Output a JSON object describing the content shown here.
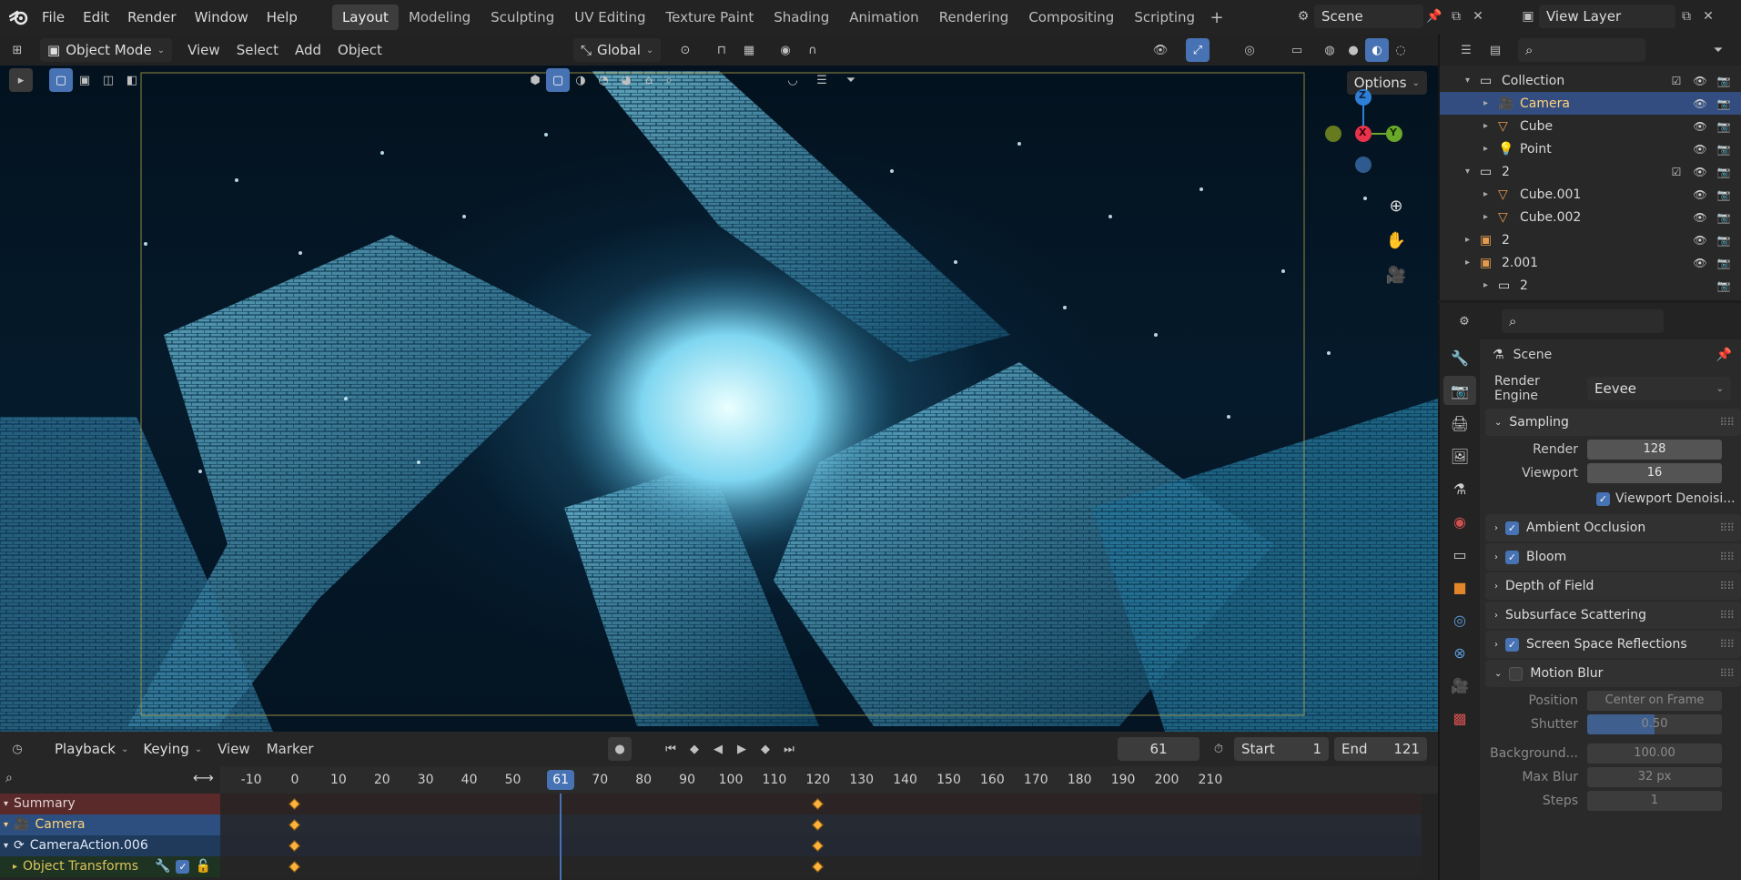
{
  "menu": [
    "File",
    "Edit",
    "Render",
    "Window",
    "Help"
  ],
  "workspaces": [
    {
      "label": "Layout",
      "active": true
    },
    {
      "label": "Modeling"
    },
    {
      "label": "Sculpting"
    },
    {
      "label": "UV Editing"
    },
    {
      "label": "Texture Paint"
    },
    {
      "label": "Shading"
    },
    {
      "label": "Animation"
    },
    {
      "label": "Rendering"
    },
    {
      "label": "Compositing"
    },
    {
      "label": "Scripting"
    }
  ],
  "scene": {
    "name": "Scene"
  },
  "view_layer": {
    "name": "View Layer"
  },
  "viewport": {
    "mode": "Object Mode",
    "menus": [
      "View",
      "Select",
      "Add",
      "Object"
    ],
    "transform_orientation": "Global",
    "options_label": "Options",
    "gizmo": {
      "z": "Z",
      "x": "X",
      "y": "Y"
    }
  },
  "outliner": {
    "rows": [
      {
        "label": "Collection",
        "indent": 1,
        "icon": "collection",
        "checkbox": true
      },
      {
        "label": "Camera",
        "indent": 2,
        "icon": "camera",
        "selected": true
      },
      {
        "label": "Cube",
        "indent": 2,
        "icon": "mesh"
      },
      {
        "label": "Point",
        "indent": 2,
        "icon": "light"
      },
      {
        "label": "2",
        "indent": 1,
        "icon": "collection",
        "checkbox": true
      },
      {
        "label": "Cube.001",
        "indent": 2,
        "icon": "mesh"
      },
      {
        "label": "Cube.002",
        "indent": 2,
        "icon": "mesh"
      },
      {
        "label": "2",
        "indent": 1,
        "icon": "instance"
      },
      {
        "label": "2.001",
        "indent": 1,
        "icon": "instance"
      },
      {
        "label": "2",
        "indent": 2,
        "icon": "collection-sub"
      }
    ]
  },
  "properties": {
    "context": "Scene",
    "render_engine_label": "Render Engine",
    "render_engine": "Eevee",
    "sampling": {
      "title": "Sampling",
      "render_label": "Render",
      "render": "128",
      "viewport_label": "Viewport",
      "viewport": "16",
      "denoise_label": "Viewport Denoisi..."
    },
    "panels": [
      {
        "label": "Ambient Occlusion",
        "checkbox": true,
        "checked": true
      },
      {
        "label": "Bloom",
        "checkbox": true,
        "checked": true
      },
      {
        "label": "Depth of Field",
        "checkbox": false
      },
      {
        "label": "Subsurface Scattering",
        "checkbox": false
      },
      {
        "label": "Screen Space Reflections",
        "checkbox": true,
        "checked": true
      }
    ],
    "motion_blur": {
      "title": "Motion Blur",
      "position_label": "Position",
      "position": "Center on Frame",
      "shutter_label": "Shutter",
      "shutter": "0.50",
      "shutter_fraction": 0.5,
      "background_label": "Background...",
      "background": "100.00",
      "max_blur_label": "Max Blur",
      "max_blur": "32 px",
      "steps_label": "Steps",
      "steps": "1"
    }
  },
  "timeline": {
    "menus": [
      "Playback",
      "Keying",
      "View",
      "Marker"
    ],
    "current_frame": "61",
    "start_label": "Start",
    "start": "1",
    "end_label": "End",
    "end": "121",
    "ticks": [
      "-10",
      "0",
      "10",
      "20",
      "30",
      "40",
      "50",
      "70",
      "80",
      "90",
      "100",
      "110",
      "120",
      "130",
      "140",
      "150",
      "160",
      "170",
      "180",
      "190",
      "200",
      "210"
    ],
    "channels": [
      {
        "label": "Summary"
      },
      {
        "label": "Camera"
      },
      {
        "label": "CameraAction.006"
      },
      {
        "label": "Object Transforms"
      }
    ],
    "keyframes": [
      0,
      120
    ]
  },
  "colors": {
    "accent": "#4772b3",
    "selection": "#334d80",
    "keyframe": "#ffb33c",
    "summary_row": "#5a2a2a"
  }
}
